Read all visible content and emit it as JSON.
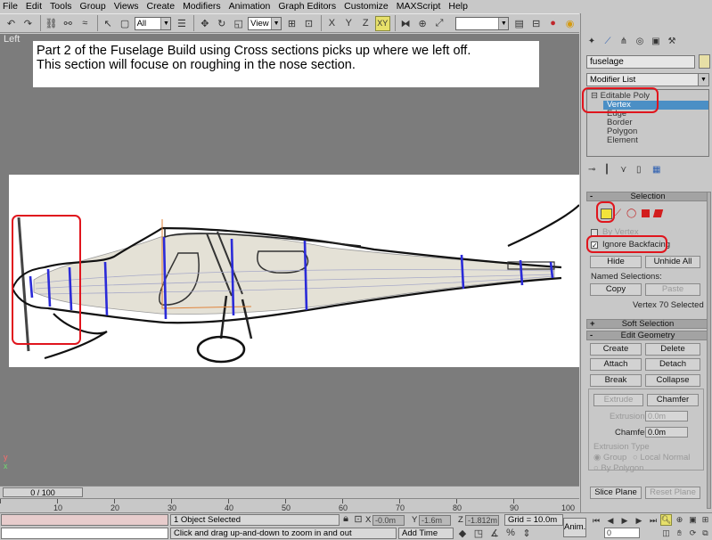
{
  "menu": [
    "File",
    "Edit",
    "Tools",
    "Group",
    "Views",
    "Create",
    "Modifiers",
    "Animation",
    "Graph Editors",
    "Customize",
    "MAXScript",
    "Help"
  ],
  "toolbar": {
    "selection_filter": "All",
    "ref_coord": "View",
    "named_selection": ""
  },
  "viewport": {
    "label": "Left",
    "note_line1": "Part 2 of the Fuselage Build using Cross sections picks up where we left off.",
    "note_line2": "This section will focuse on roughing in the nose section."
  },
  "time": {
    "slider": "0 / 100",
    "ticks": [
      "10",
      "20",
      "30",
      "40",
      "50",
      "60",
      "70",
      "80",
      "90",
      "100"
    ]
  },
  "status": {
    "selection": "1 Object Selected",
    "prompt": "Click and drag up-and-down to zoom in and out",
    "x_label": "X",
    "x_value": "-0.0m",
    "y_label": "Y",
    "y_value": "-1.6m",
    "z_label": "Z",
    "z_value": "-1.812m",
    "grid": "Grid = 10.0m",
    "add_time_tag": "Add Time Tag",
    "anim": "Anim.",
    "frame": "0"
  },
  "panel": {
    "object_name": "fuselage",
    "object_color": "#e7dfa6",
    "modifier_list": "Modifier List",
    "stack": [
      "Editable Poly",
      "Vertex",
      "Edge",
      "Border",
      "Polygon",
      "Element"
    ],
    "selection_header": "Selection",
    "by_vertex": "By Vertex",
    "ignore_backfacing": "Ignore Backfacing",
    "hide": "Hide",
    "unhide_all": "Unhide All",
    "named_selections": "Named Selections:",
    "copy": "Copy",
    "paste": "Paste",
    "selected_info": "Vertex 70 Selected",
    "soft_selection": "Soft Selection",
    "edit_geometry": "Edit Geometry",
    "create": "Create",
    "delete": "Delete",
    "attach": "Attach",
    "detach": "Detach",
    "break": "Break",
    "collapse": "Collapse",
    "extrude": "Extrude",
    "chamfer": "Chamfer",
    "extrusion_label": "Extrusion",
    "extrusion_value": "0.0m",
    "chamfer_label": "Chamfer",
    "chamfer_value": "0.0m",
    "extrusion_type": "Extrusion Type",
    "group": "Group",
    "local_normal": "Local Normal",
    "by_polygon": "By Polygon",
    "slice_plane": "Slice Plane",
    "reset_plane": "Reset Plane"
  },
  "colors": {
    "annotation_red": "#e0151d",
    "selected_vertex": "#3a3ae6",
    "viewport_bg": "#7c7c7c"
  }
}
